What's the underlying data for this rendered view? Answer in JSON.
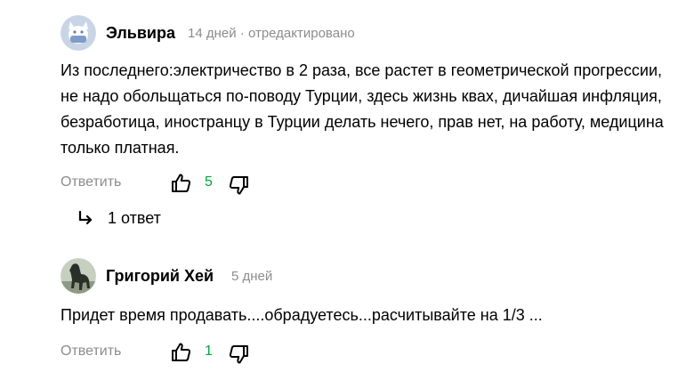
{
  "comments": [
    {
      "author": "Эльвира",
      "meta": "14 дней · отредактировано",
      "text": "Из последнего:электричество в 2 раза, все растет в геометрической прогрессии, не надо обольщаться по-поводу Турции, здесь жизнь кваx, дичайшая инфляция, безработица, иностранцу в Турции делать нечего, прав нет, на работу, медицина только платная.",
      "reply_label": "Ответить",
      "likes": "5",
      "replies_label": "1 ответ"
    },
    {
      "author": "Григорий Хей",
      "meta": "5 дней",
      "text": "Придет время продавать....обрадуетесь...расчитывайте на 1/3 ...",
      "reply_label": "Ответить",
      "likes": "1"
    }
  ],
  "colors": {
    "like_count": "#00a63e",
    "secondary_text": "#8c8c8c",
    "avatar_bg": "#c9d4e6"
  },
  "icons": {
    "like": "thumbs-up-icon",
    "dislike": "thumbs-down-icon",
    "reply_arrow": "reply-arrow-icon"
  }
}
